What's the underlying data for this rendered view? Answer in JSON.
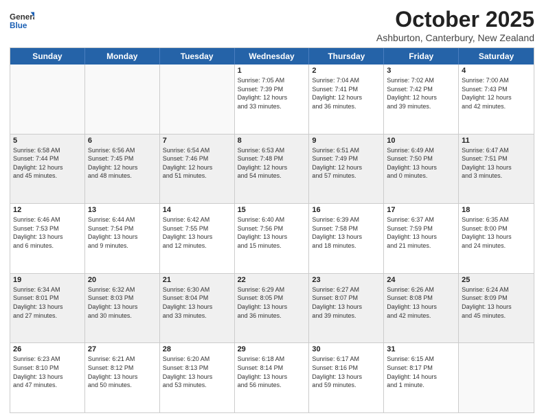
{
  "header": {
    "logo_general": "General",
    "logo_blue": "Blue",
    "month_title": "October 2025",
    "location": "Ashburton, Canterbury, New Zealand"
  },
  "weekdays": [
    "Sunday",
    "Monday",
    "Tuesday",
    "Wednesday",
    "Thursday",
    "Friday",
    "Saturday"
  ],
  "rows": [
    [
      {
        "day": "",
        "info": "",
        "empty": true
      },
      {
        "day": "",
        "info": "",
        "empty": true
      },
      {
        "day": "",
        "info": "",
        "empty": true
      },
      {
        "day": "1",
        "info": "Sunrise: 7:05 AM\nSunset: 7:39 PM\nDaylight: 12 hours\nand 33 minutes."
      },
      {
        "day": "2",
        "info": "Sunrise: 7:04 AM\nSunset: 7:41 PM\nDaylight: 12 hours\nand 36 minutes."
      },
      {
        "day": "3",
        "info": "Sunrise: 7:02 AM\nSunset: 7:42 PM\nDaylight: 12 hours\nand 39 minutes."
      },
      {
        "day": "4",
        "info": "Sunrise: 7:00 AM\nSunset: 7:43 PM\nDaylight: 12 hours\nand 42 minutes."
      }
    ],
    [
      {
        "day": "5",
        "info": "Sunrise: 6:58 AM\nSunset: 7:44 PM\nDaylight: 12 hours\nand 45 minutes.",
        "shaded": true
      },
      {
        "day": "6",
        "info": "Sunrise: 6:56 AM\nSunset: 7:45 PM\nDaylight: 12 hours\nand 48 minutes.",
        "shaded": true
      },
      {
        "day": "7",
        "info": "Sunrise: 6:54 AM\nSunset: 7:46 PM\nDaylight: 12 hours\nand 51 minutes.",
        "shaded": true
      },
      {
        "day": "8",
        "info": "Sunrise: 6:53 AM\nSunset: 7:48 PM\nDaylight: 12 hours\nand 54 minutes.",
        "shaded": true
      },
      {
        "day": "9",
        "info": "Sunrise: 6:51 AM\nSunset: 7:49 PM\nDaylight: 12 hours\nand 57 minutes.",
        "shaded": true
      },
      {
        "day": "10",
        "info": "Sunrise: 6:49 AM\nSunset: 7:50 PM\nDaylight: 13 hours\nand 0 minutes.",
        "shaded": true
      },
      {
        "day": "11",
        "info": "Sunrise: 6:47 AM\nSunset: 7:51 PM\nDaylight: 13 hours\nand 3 minutes.",
        "shaded": true
      }
    ],
    [
      {
        "day": "12",
        "info": "Sunrise: 6:46 AM\nSunset: 7:53 PM\nDaylight: 13 hours\nand 6 minutes."
      },
      {
        "day": "13",
        "info": "Sunrise: 6:44 AM\nSunset: 7:54 PM\nDaylight: 13 hours\nand 9 minutes."
      },
      {
        "day": "14",
        "info": "Sunrise: 6:42 AM\nSunset: 7:55 PM\nDaylight: 13 hours\nand 12 minutes."
      },
      {
        "day": "15",
        "info": "Sunrise: 6:40 AM\nSunset: 7:56 PM\nDaylight: 13 hours\nand 15 minutes."
      },
      {
        "day": "16",
        "info": "Sunrise: 6:39 AM\nSunset: 7:58 PM\nDaylight: 13 hours\nand 18 minutes."
      },
      {
        "day": "17",
        "info": "Sunrise: 6:37 AM\nSunset: 7:59 PM\nDaylight: 13 hours\nand 21 minutes."
      },
      {
        "day": "18",
        "info": "Sunrise: 6:35 AM\nSunset: 8:00 PM\nDaylight: 13 hours\nand 24 minutes."
      }
    ],
    [
      {
        "day": "19",
        "info": "Sunrise: 6:34 AM\nSunset: 8:01 PM\nDaylight: 13 hours\nand 27 minutes.",
        "shaded": true
      },
      {
        "day": "20",
        "info": "Sunrise: 6:32 AM\nSunset: 8:03 PM\nDaylight: 13 hours\nand 30 minutes.",
        "shaded": true
      },
      {
        "day": "21",
        "info": "Sunrise: 6:30 AM\nSunset: 8:04 PM\nDaylight: 13 hours\nand 33 minutes.",
        "shaded": true
      },
      {
        "day": "22",
        "info": "Sunrise: 6:29 AM\nSunset: 8:05 PM\nDaylight: 13 hours\nand 36 minutes.",
        "shaded": true
      },
      {
        "day": "23",
        "info": "Sunrise: 6:27 AM\nSunset: 8:07 PM\nDaylight: 13 hours\nand 39 minutes.",
        "shaded": true
      },
      {
        "day": "24",
        "info": "Sunrise: 6:26 AM\nSunset: 8:08 PM\nDaylight: 13 hours\nand 42 minutes.",
        "shaded": true
      },
      {
        "day": "25",
        "info": "Sunrise: 6:24 AM\nSunset: 8:09 PM\nDaylight: 13 hours\nand 45 minutes.",
        "shaded": true
      }
    ],
    [
      {
        "day": "26",
        "info": "Sunrise: 6:23 AM\nSunset: 8:10 PM\nDaylight: 13 hours\nand 47 minutes."
      },
      {
        "day": "27",
        "info": "Sunrise: 6:21 AM\nSunset: 8:12 PM\nDaylight: 13 hours\nand 50 minutes."
      },
      {
        "day": "28",
        "info": "Sunrise: 6:20 AM\nSunset: 8:13 PM\nDaylight: 13 hours\nand 53 minutes."
      },
      {
        "day": "29",
        "info": "Sunrise: 6:18 AM\nSunset: 8:14 PM\nDaylight: 13 hours\nand 56 minutes."
      },
      {
        "day": "30",
        "info": "Sunrise: 6:17 AM\nSunset: 8:16 PM\nDaylight: 13 hours\nand 59 minutes."
      },
      {
        "day": "31",
        "info": "Sunrise: 6:15 AM\nSunset: 8:17 PM\nDaylight: 14 hours\nand 1 minute."
      },
      {
        "day": "",
        "info": "",
        "empty": true
      }
    ]
  ]
}
